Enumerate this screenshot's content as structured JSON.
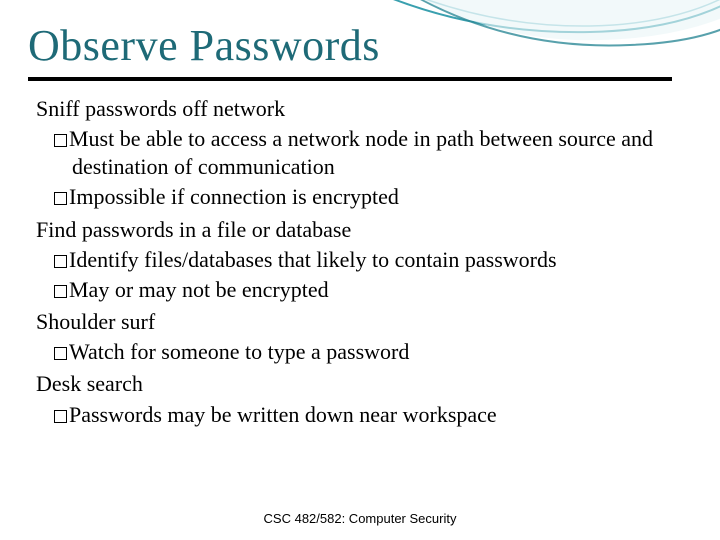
{
  "title": "Observe Passwords",
  "sections": [
    {
      "heading": "Sniff passwords off network",
      "bullets": [
        "Must be able to access a network node in path between source and destination of communication",
        "Impossible if connection is encrypted"
      ]
    },
    {
      "heading": "Find passwords in a file or database",
      "bullets": [
        "Identify files/databases that likely to contain passwords",
        "May or may not be encrypted"
      ]
    },
    {
      "heading": "Shoulder surf",
      "bullets": [
        "Watch for someone to type a password"
      ]
    },
    {
      "heading": "Desk search",
      "bullets": [
        "Passwords may be written down near workspace"
      ]
    }
  ],
  "footer": "CSC 482/582: Computer Security"
}
